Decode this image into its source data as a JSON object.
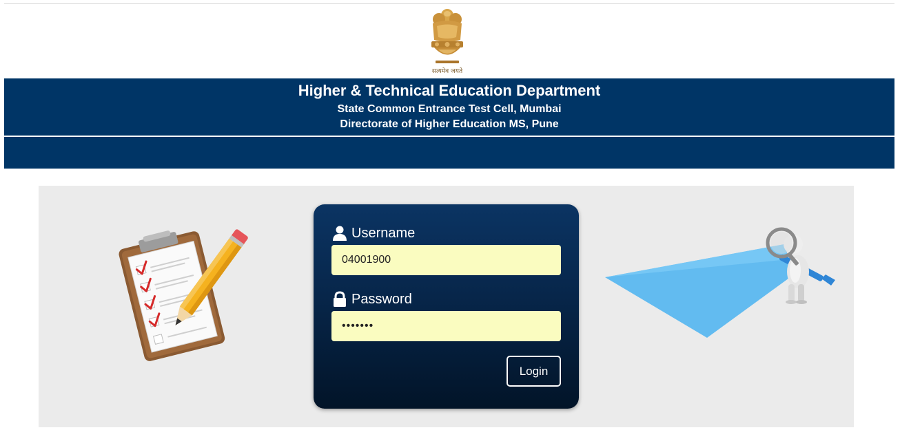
{
  "header": {
    "emblem_motto": "सत्यमेव जयते",
    "title": "Higher & Technical Education Department",
    "subtitle_1": "State Common Entrance Test Cell, Mumbai",
    "subtitle_2": "Directorate of Higher Education MS, Pune"
  },
  "login": {
    "username_label": "Username",
    "username_value": "04001900",
    "password_label": "Password",
    "password_value": "1234567",
    "submit_label": "Login"
  },
  "icons": {
    "username": "user-icon",
    "password": "lock-icon",
    "emblem": "national-emblem-icon",
    "left_art": "clipboard-checklist-icon",
    "right_art": "magnifier-searchlight-icon"
  },
  "colors": {
    "header_band": "#003566",
    "card_top": "#0b3463",
    "card_bottom": "#021428",
    "input_bg": "#fafcc0",
    "panel_bg": "#ebebeb",
    "beam": "#5bb8f0"
  }
}
